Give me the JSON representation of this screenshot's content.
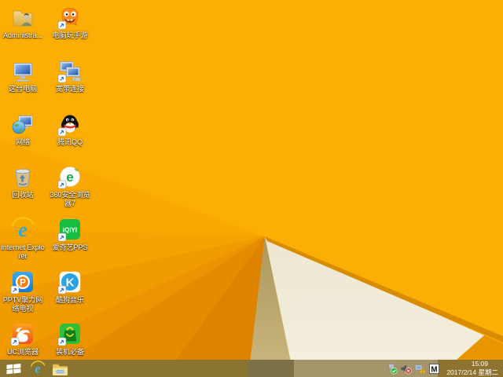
{
  "desktop": {
    "icons": [
      {
        "label": "Administra...",
        "shortcut": false
      },
      {
        "label": "电脑玩手游",
        "shortcut": true
      },
      {
        "label": "这台电脑",
        "shortcut": false
      },
      {
        "label": "宽带连接",
        "shortcut": true
      },
      {
        "label": "网络",
        "shortcut": false
      },
      {
        "label": "腾讯QQ",
        "shortcut": true
      },
      {
        "label": "回收站",
        "shortcut": false
      },
      {
        "label": "360安全浏览器7",
        "shortcut": true
      },
      {
        "label": "Internet Explorer",
        "shortcut": false
      },
      {
        "label": "爱奇艺PPS",
        "shortcut": true
      },
      {
        "label": "PPTV聚力网络电视",
        "shortcut": true
      },
      {
        "label": "酷狗音乐",
        "shortcut": true
      },
      {
        "label": "UC浏览器",
        "shortcut": true
      },
      {
        "label": "装机必备",
        "shortcut": true
      }
    ]
  },
  "logo_glyphs": {
    "ie_e": "e",
    "e360": "e",
    "iqiyi": "iQIYI",
    "pptv_p": "P",
    "kugou_k": "K"
  },
  "wallpaper_colors": {
    "base": "#FBAE04",
    "cream": "#F1EBDA",
    "tan": "#BCA76E",
    "ridge": "#D88C00",
    "bottom_right": "#E89500",
    "fan_shades": [
      "#F8A800",
      "#F5A300",
      "#F09B00",
      "#EB9300",
      "#E58B00",
      "#DE8300"
    ],
    "taskbar_olive": "#8A7530"
  },
  "taskbar": {
    "tray": {
      "ime_label": "M",
      "clock": {
        "time": "15:09",
        "date": "2017/2/14 星期二"
      }
    }
  }
}
